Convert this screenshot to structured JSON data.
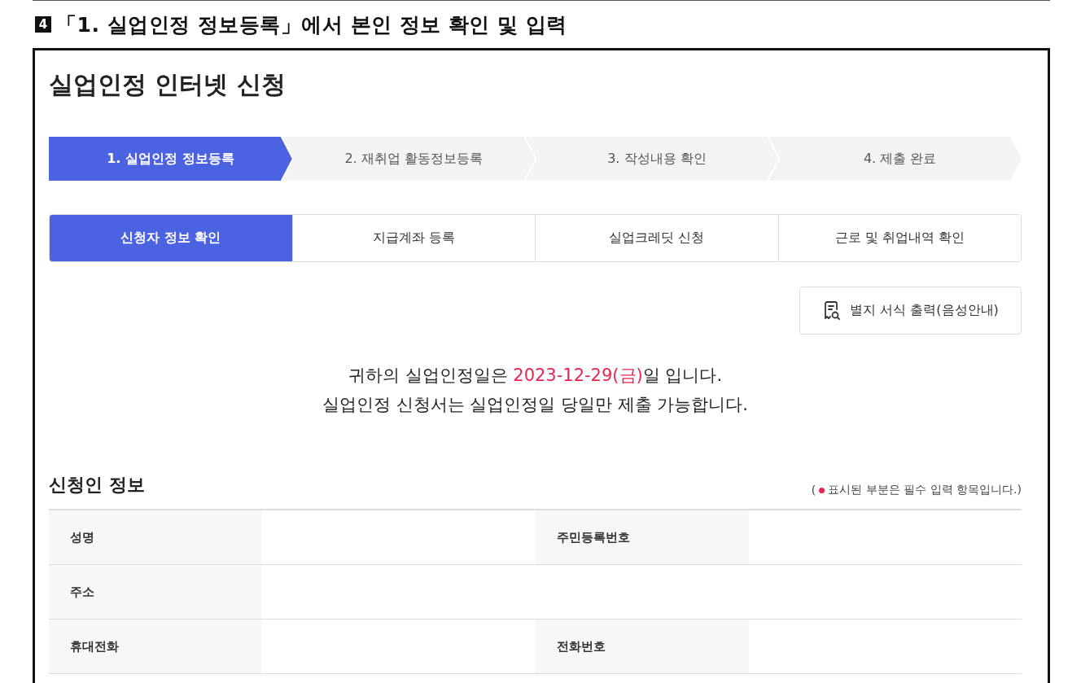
{
  "heading": {
    "badge": "4",
    "text": "「1. 실업인정 정보등록」에서 본인 정보 확인 및 입력"
  },
  "page_title": "실업인정 인터넷 신청",
  "steps": [
    {
      "label": "1. 실업인정 정보등록",
      "selected": true
    },
    {
      "label": "2. 재취업 활동정보등록",
      "selected": false
    },
    {
      "label": "3. 작성내용 확인",
      "selected": false
    },
    {
      "label": "4. 제출 완료",
      "selected": false
    }
  ],
  "tabs": [
    {
      "label": "신청자 정보 확인",
      "selected": true
    },
    {
      "label": "지급계좌 등록",
      "selected": false
    },
    {
      "label": "실업크레딧 신청",
      "selected": false
    },
    {
      "label": "근로 및 취업내역 확인",
      "selected": false
    }
  ],
  "print_button": "별지 서식 출력(음성안내)",
  "notice": [
    "귀하의 실업인정일은 **2023-12-29(금)**일 입니다.",
    "실업인정 신청서는 실업인정일 당일만 제출 가능합니다."
  ],
  "section": {
    "title": "신청인 정보",
    "note_open": "(",
    "note_text": "표시된 부분은 필수 입력 항목입니다.)"
  },
  "table": {
    "rows": [
      [
        {
          "label": "성명"
        },
        {
          "label": "주민등록번호"
        }
      ],
      [
        {
          "label": "주소"
        }
      ],
      [
        {
          "label": "휴대전화"
        },
        {
          "label": "전화번호"
        }
      ]
    ]
  }
}
